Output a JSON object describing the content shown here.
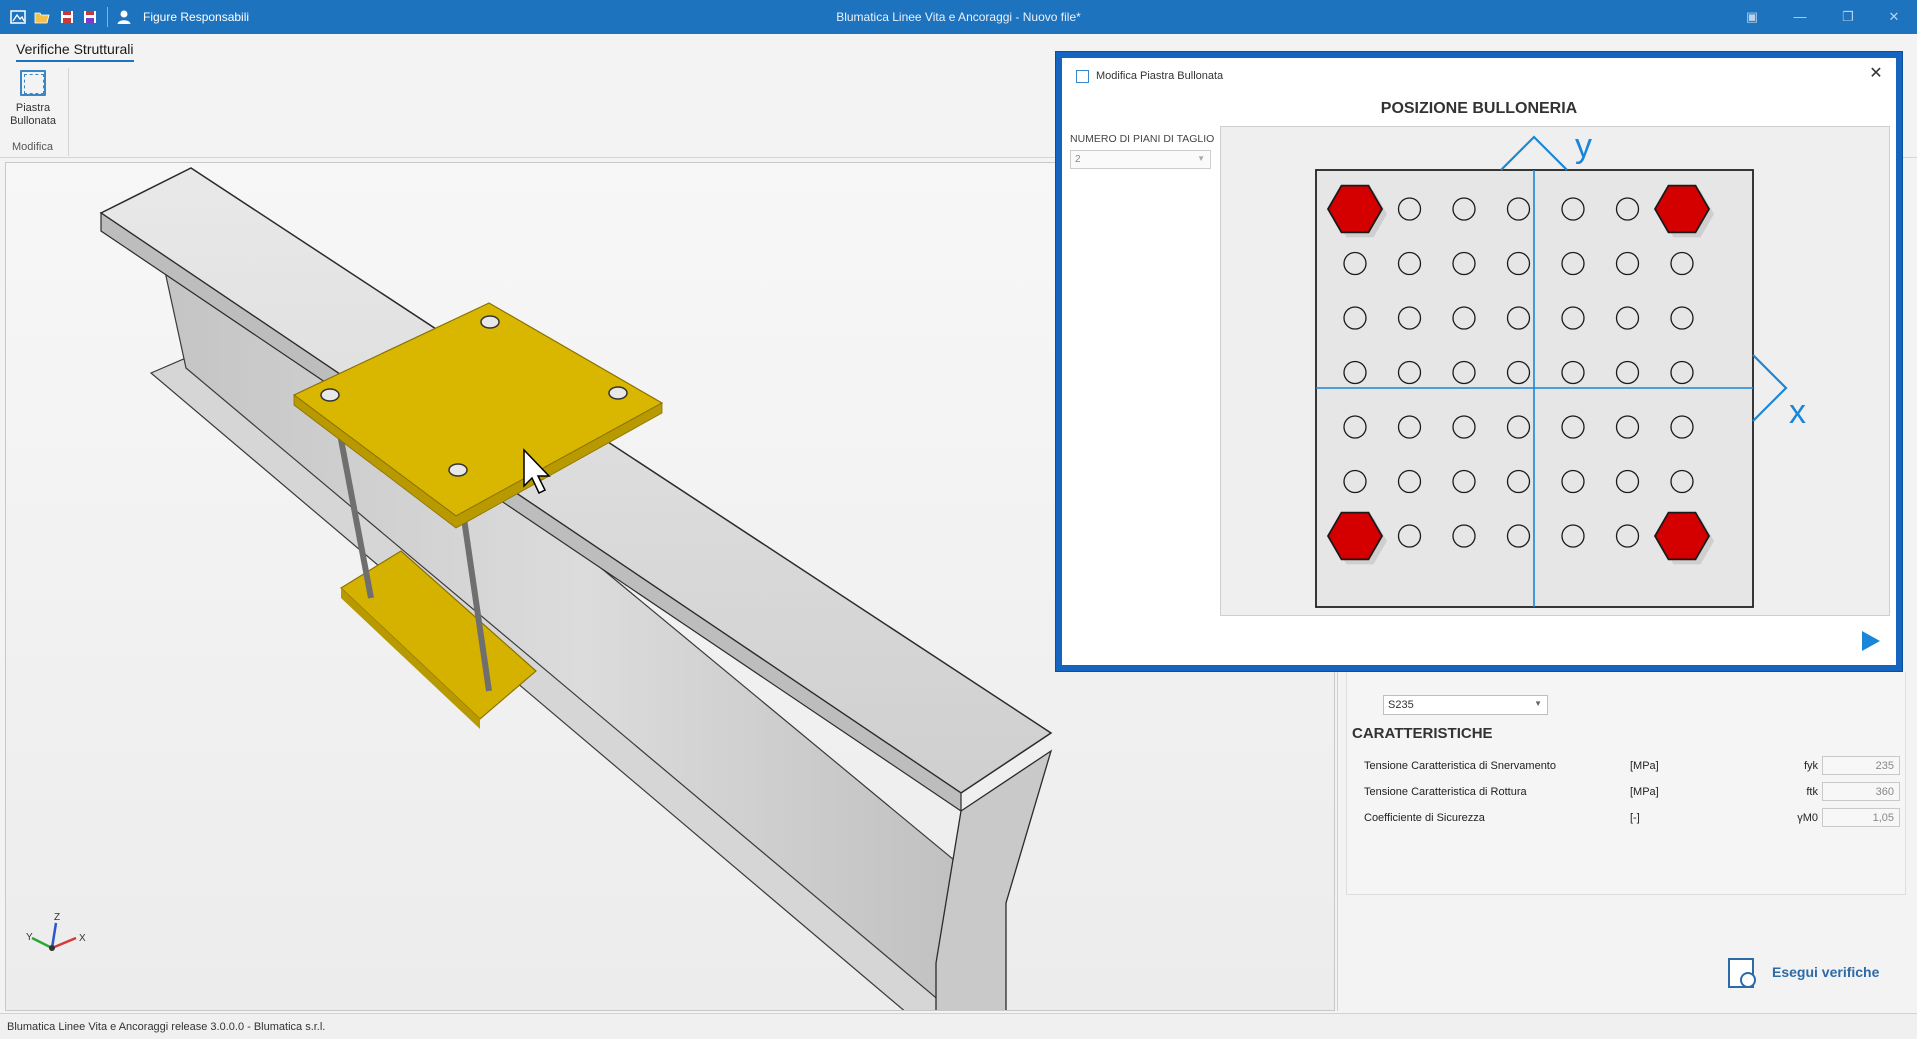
{
  "app": {
    "window_title": "Blumatica Linee Vita e Ancoraggi - Nuovo file*",
    "quick_access_user_label": "Figure Responsabili",
    "status_text": "Blumatica Linee Vita e Ancoraggi release 3.0.0.0 - Blumatica s.r.l."
  },
  "ribbon": {
    "tab_label": "Verifiche Strutturali",
    "button_label_line1": "Piastra",
    "button_label_line2": "Bullonata",
    "group_label": "Modifica"
  },
  "viewport": {
    "axis_labels": {
      "x": "X",
      "y": "Y",
      "z": "Z"
    }
  },
  "dialog": {
    "title": "Modifica Piastra Bullonata",
    "heading": "POSIZIONE BULLONERIA",
    "field_label": "NUMERO DI PIANI DI TAGLIO",
    "field_value": "2",
    "axis_x_label": "x",
    "axis_y_label": "y",
    "grid_rows": 7,
    "grid_cols": 7,
    "bolts": [
      [
        0,
        0
      ],
      [
        0,
        6
      ],
      [
        6,
        0
      ],
      [
        6,
        6
      ]
    ],
    "colors": {
      "bolt": "#d40000",
      "axis": "#1a86d8",
      "border": "#1565c0"
    }
  },
  "panel": {
    "steel_grade": "S235",
    "section_title": "CARATTERISTICHE",
    "properties": [
      {
        "name": "Tensione Caratteristica di Snervamento",
        "unit": "[MPa]",
        "symbol": "fyk",
        "value": "235"
      },
      {
        "name": "Tensione Caratteristica di Rottura",
        "unit": "[MPa]",
        "symbol": "ftk",
        "value": "360"
      },
      {
        "name": "Coefficiente di Sicurezza",
        "unit": "[-]",
        "symbol": "γM0",
        "value": "1,05"
      }
    ],
    "run_button_label": "Esegui verifiche"
  }
}
